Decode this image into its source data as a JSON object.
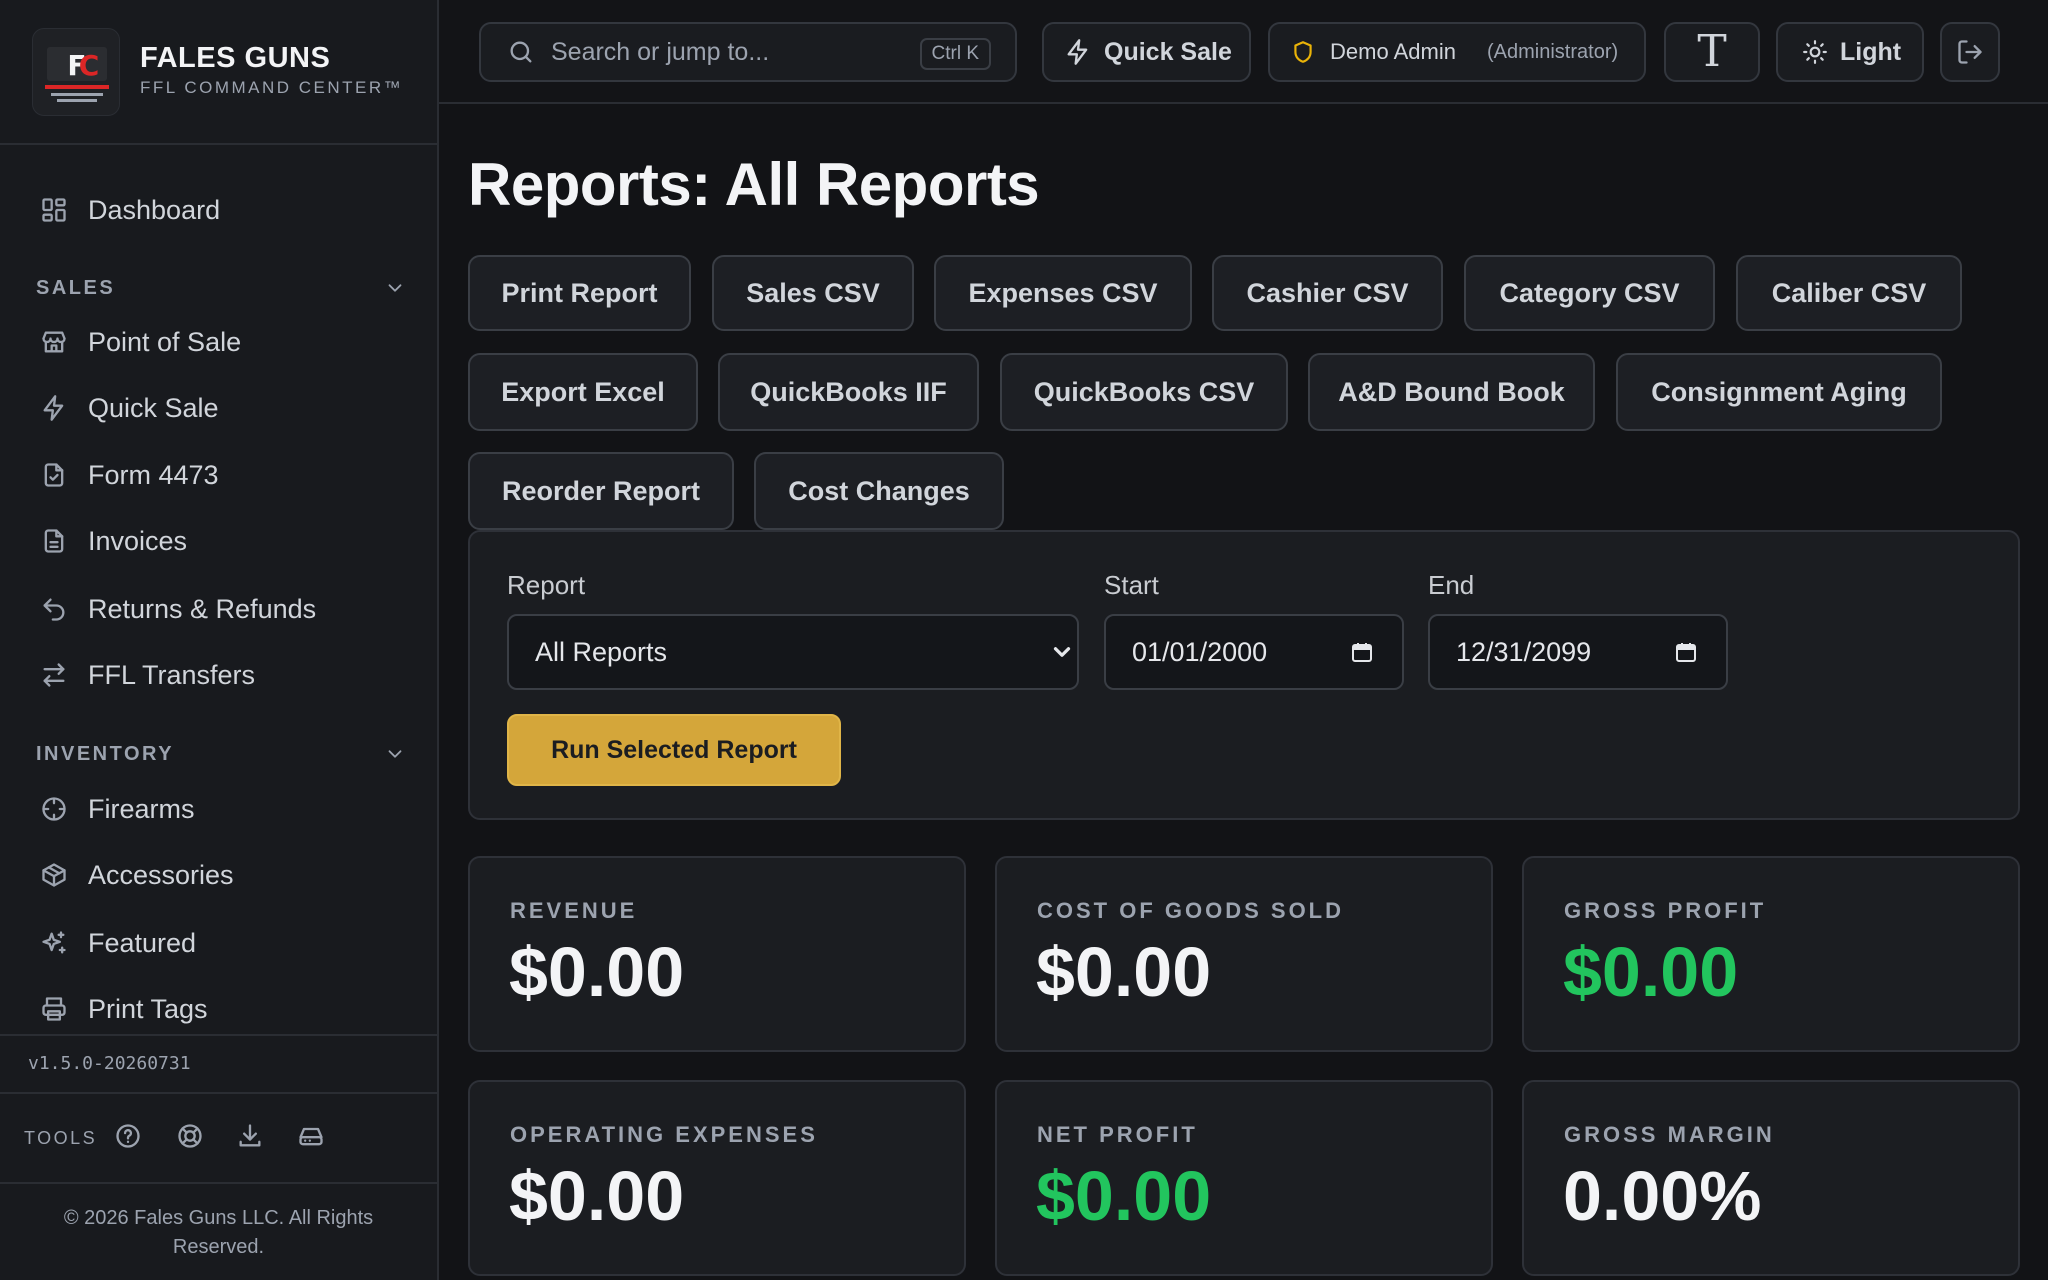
{
  "brand": {
    "name": "FALES GUNS",
    "subtitle": "FFL COMMAND CENTER™",
    "logo_text": "FC",
    "logo_caption": "FFL COMMAND CENTER"
  },
  "sidebar": {
    "items_top": [
      {
        "label": "Dashboard",
        "icon": "grid-icon"
      }
    ],
    "sections": [
      {
        "title": "SALES",
        "items": [
          {
            "label": "Point of Sale",
            "icon": "store-icon"
          },
          {
            "label": "Quick Sale",
            "icon": "bolt-icon"
          },
          {
            "label": "Form 4473",
            "icon": "file-check-icon"
          },
          {
            "label": "Invoices",
            "icon": "file-text-icon"
          },
          {
            "label": "Returns & Refunds",
            "icon": "undo-icon"
          },
          {
            "label": "FFL Transfers",
            "icon": "arrows-icon"
          }
        ]
      },
      {
        "title": "INVENTORY",
        "items": [
          {
            "label": "Firearms",
            "icon": "crosshair-icon"
          },
          {
            "label": "Accessories",
            "icon": "box-icon"
          },
          {
            "label": "Featured",
            "icon": "sparkles-icon"
          },
          {
            "label": "Print Tags",
            "icon": "printer-icon"
          }
        ]
      }
    ],
    "version": "v1.5.0-20260731",
    "tools_label": "TOOLS",
    "copyright": "© 2026 Fales Guns LLC. All Rights Reserved."
  },
  "topbar": {
    "search_placeholder": "Search or jump to...",
    "search_shortcut": "Ctrl K",
    "quick_sale": "Quick Sale",
    "user_name": "Demo Admin",
    "user_role": "(Administrator)",
    "font_toggle": "T",
    "theme": "Light"
  },
  "page": {
    "title": "Reports: All Reports"
  },
  "report_buttons": [
    "Print Report",
    "Sales CSV",
    "Expenses CSV",
    "Cashier CSV",
    "Category CSV",
    "Caliber CSV",
    "Export Excel",
    "QuickBooks IIF",
    "QuickBooks CSV",
    "A&D Bound Book",
    "Consignment Aging",
    "Reorder Report",
    "Cost Changes"
  ],
  "filters": {
    "report_label": "Report",
    "report_value": "All Reports",
    "start_label": "Start",
    "start_value": "01/01/2000",
    "end_label": "End",
    "end_value": "12/31/2099",
    "run_button": "Run Selected Report"
  },
  "metrics": [
    {
      "label": "REVENUE",
      "value": "$0.00",
      "color": "#f3f4f6"
    },
    {
      "label": "COST OF GOODS SOLD",
      "value": "$0.00",
      "color": "#f3f4f6"
    },
    {
      "label": "GROSS PROFIT",
      "value": "$0.00",
      "color": "#22c55e"
    },
    {
      "label": "OPERATING EXPENSES",
      "value": "$0.00",
      "color": "#f3f4f6"
    },
    {
      "label": "NET PROFIT",
      "value": "$0.00",
      "color": "#22c55e"
    },
    {
      "label": "GROSS MARGIN",
      "value": "0.00%",
      "color": "#f3f4f6"
    }
  ],
  "colors": {
    "accent": "#d4a63a",
    "positive": "#22c55e",
    "shield": "#eab308"
  }
}
